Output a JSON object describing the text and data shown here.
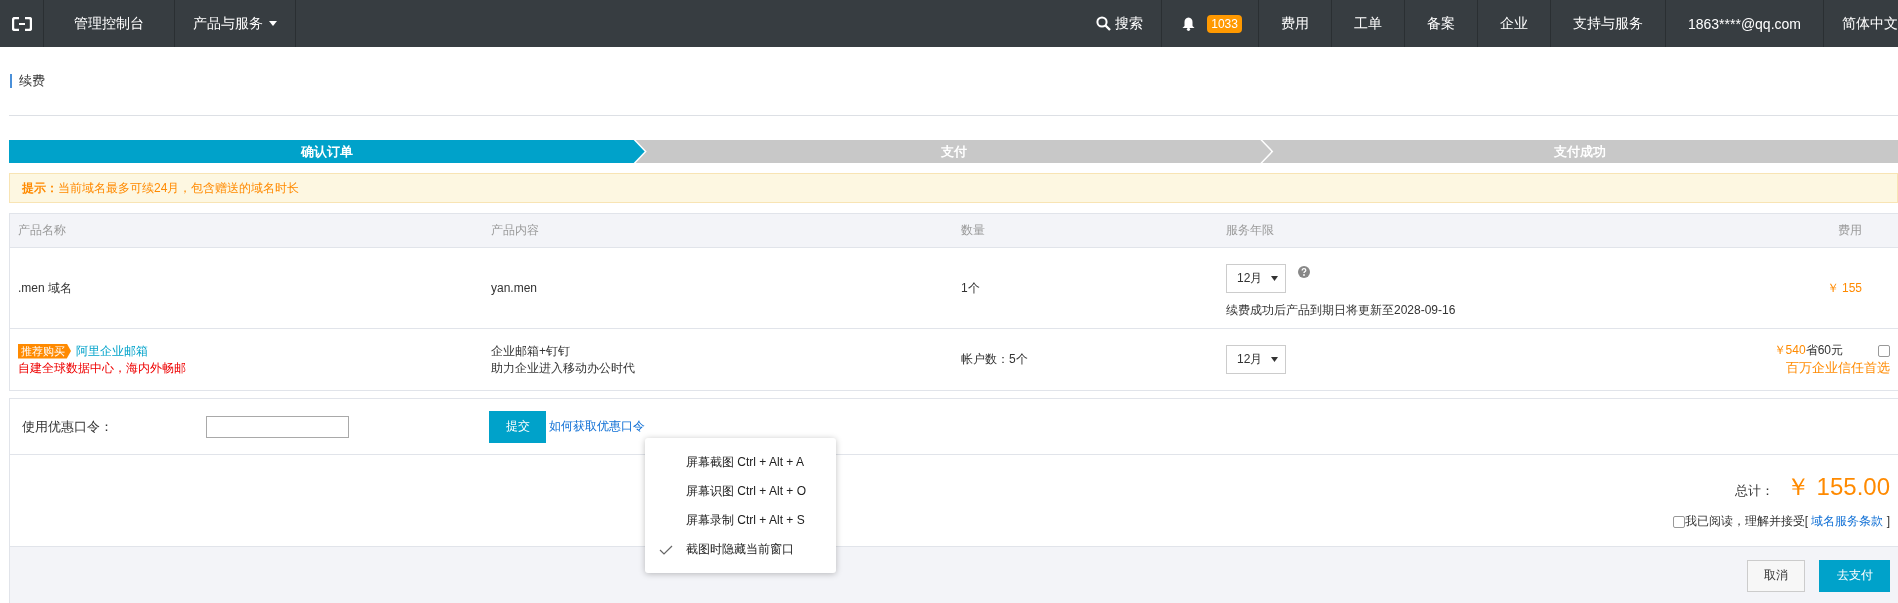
{
  "header": {
    "console": "管理控制台",
    "products": "产品与服务",
    "search": "搜索",
    "notifications": "1033",
    "links": [
      "费用",
      "工单",
      "备案",
      "企业",
      "支持与服务",
      "1863****@qq.com",
      "简体中文"
    ]
  },
  "breadcrumb": "续费",
  "steps": [
    {
      "label": "确认订单",
      "selected": true
    },
    {
      "label": "支付",
      "selected": false
    },
    {
      "label": "支付成功",
      "selected": false
    }
  ],
  "notice": "**提示：**当前域名最多可续24月，包含赠送的域名时长",
  "table": {
    "columns": [
      "产品名称",
      "产品内容",
      "数量",
      "服务年限",
      "费用"
    ],
    "rows": [
      {
        "kind": "domain",
        "name": ".men 域名",
        "content": "yan.men",
        "quantity": "1个",
        "period": "12月",
        "period_note": "续费成功后产品到期日将更新至2028-09-16",
        "fee": "￥ 155"
      },
      {
        "kind": "promo",
        "badge": "推荐购买",
        "name": "阿里企业邮箱",
        "slogan": "自建全球数据中心，海内外畅邮",
        "content_lines": [
          "企业邮箱+钉钉",
          "助力企业进入移动办公时代"
        ],
        "quantity": "帐户数：5个",
        "period": "12月",
        "price": "￥540",
        "saving": "省60元",
        "tagline": "百万企业信任首选",
        "checked": false
      }
    ]
  },
  "coupon": {
    "label": "使用优惠口令：",
    "submit": "提交",
    "help_link": "如何获取优惠口令"
  },
  "total": {
    "label": "总计：",
    "amount": "￥ 155.00",
    "agreed": false,
    "agree_text": "我已阅读，理解并接受[",
    "terms_link": "域名服务条款",
    "agree_end": " ]"
  },
  "buttons": [
    {
      "label": "取消",
      "kind": "secondary"
    },
    {
      "label": "去支付",
      "kind": "primary"
    }
  ],
  "context_menu": [
    {
      "label": "屏幕截图 Ctrl + Alt + A",
      "checked": false
    },
    {
      "label": "屏幕识图 Ctrl + Alt + O",
      "checked": false
    },
    {
      "label": "屏幕录制 Ctrl + Alt + S",
      "checked": false
    },
    {
      "label": "截图时隐藏当前窗口",
      "checked": true
    }
  ]
}
